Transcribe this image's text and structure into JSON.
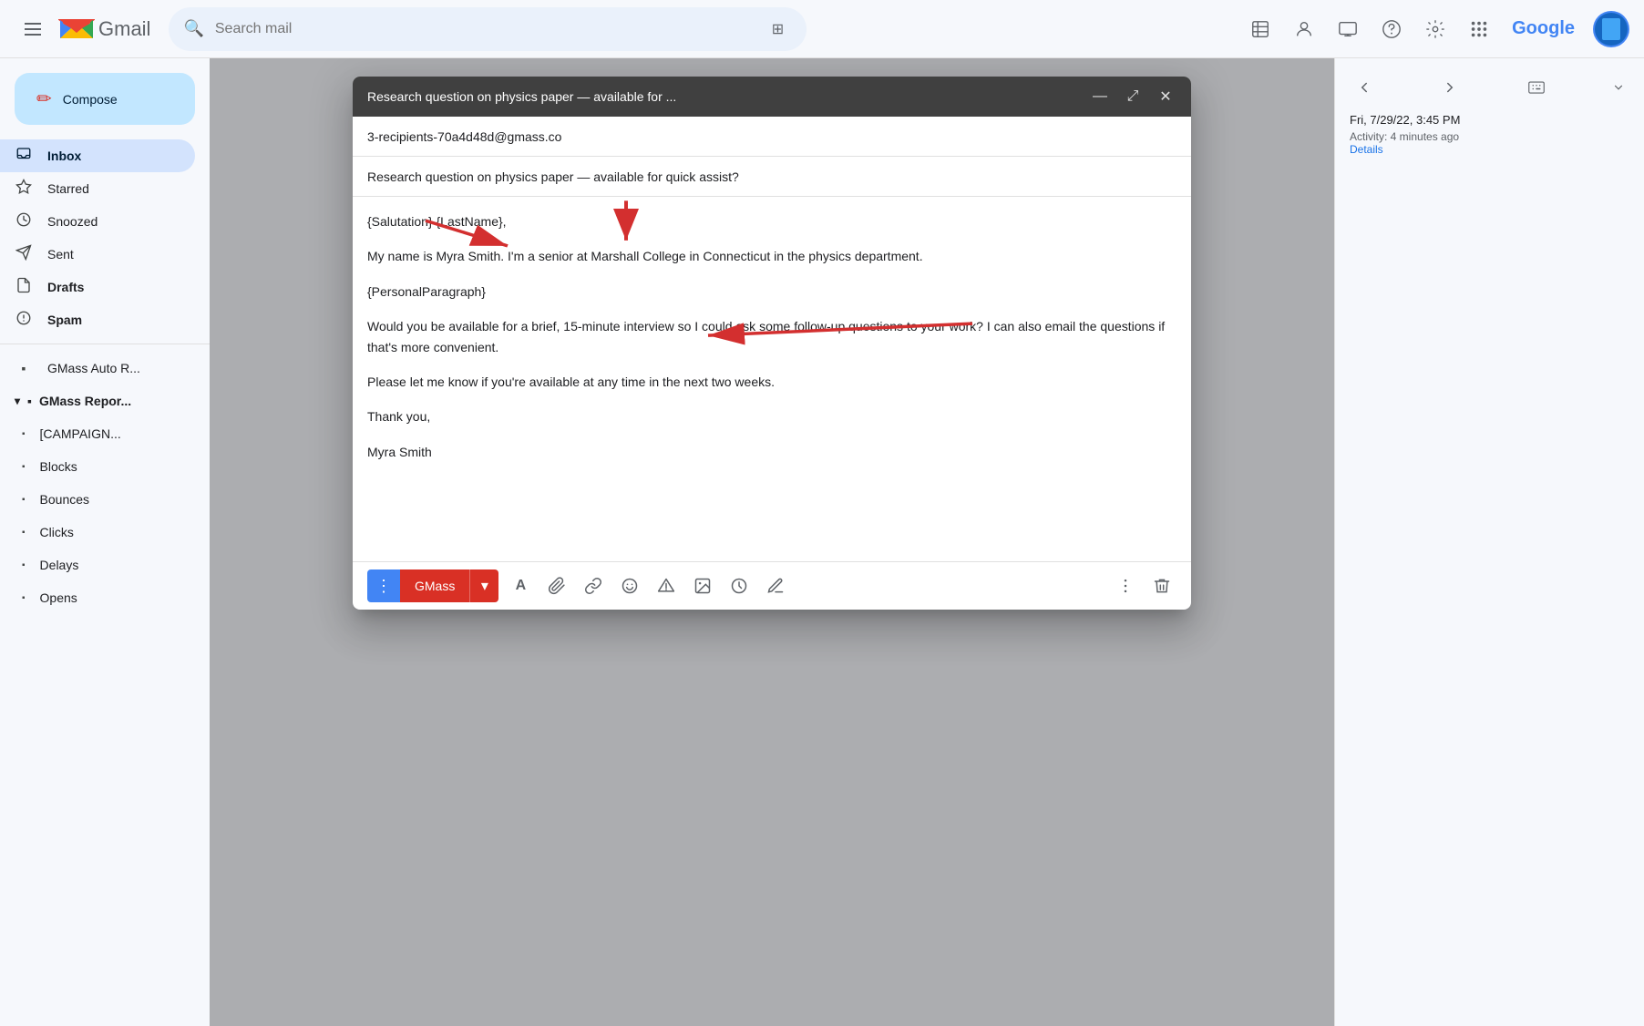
{
  "topbar": {
    "menu_label": "☰",
    "gmail_m": "M",
    "gmail_text": "Gmail",
    "search_placeholder": "Search mail",
    "icons": [
      "⊞",
      "⊟",
      "👤",
      "?",
      "⚙",
      "⋮⋮⋮"
    ],
    "google_text": "Google"
  },
  "sidebar": {
    "compose_label": "Compose",
    "items": [
      {
        "id": "inbox",
        "label": "Inbox",
        "icon": "☐",
        "active": true
      },
      {
        "id": "starred",
        "label": "Starred",
        "icon": "☆"
      },
      {
        "id": "snoozed",
        "label": "Snoozed",
        "icon": "◷"
      },
      {
        "id": "sent",
        "label": "Sent",
        "icon": "▷"
      },
      {
        "id": "drafts",
        "label": "Drafts",
        "icon": "□",
        "bold": true
      },
      {
        "id": "spam",
        "label": "Spam",
        "icon": "⊗",
        "bold": true
      }
    ],
    "gmass_auto": {
      "label": "GMass Auto R...",
      "icon": "▪"
    },
    "gmass_reports": {
      "label": "GMass Repor...",
      "icon": "▾▪"
    },
    "campaign": {
      "label": "[CAMPAIGN...",
      "icon": "▪"
    },
    "blocks": {
      "label": "Blocks",
      "icon": "▪"
    },
    "bounces": {
      "label": "Bounces",
      "icon": "▪"
    },
    "clicks": {
      "label": "Clicks",
      "icon": "▪"
    },
    "delays": {
      "label": "Delays",
      "icon": "▪"
    },
    "opens": {
      "label": "Opens",
      "icon": "▪"
    }
  },
  "compose_modal": {
    "title": "Research question on physics paper — available for ...",
    "header_buttons": {
      "minimize": "—",
      "maximize": "⤢",
      "close": "✕"
    },
    "to_field": "3-recipients-70a4d48d@gmass.co",
    "subject_field": "Research question on physics paper — available for quick assist?",
    "body": {
      "salutation": "{Salutation} {LastName},",
      "line1": "My name is Myra Smith. I'm a senior at Marshall College in Connecticut in the physics department.",
      "personal": "{PersonalParagraph}",
      "line2": "Would you be available for a brief, 15-minute interview so I could ask some follow-up questions to your work? I can also email the questions if that's more convenient.",
      "line3": "Please let me know if you're available at any time in the next two weeks.",
      "closing": "Thank you,",
      "signature": "Myra Smith"
    },
    "toolbar": {
      "dots_btn": "⋮",
      "gmass_label": "GMass",
      "gmass_arrow": "▾",
      "format_btn": "A",
      "attach_btn": "📎",
      "link_btn": "🔗",
      "emoji_btn": "☺",
      "drive_btn": "△",
      "image_btn": "🖼",
      "schedule_btn": "🕐",
      "pen_btn": "✏",
      "more_btn": "⋮",
      "delete_btn": "🗑"
    }
  },
  "right_panel": {
    "date": "Fri, 7/29/22, 3:45 PM",
    "activity": "Activity: 4 minutes ago",
    "details": "Details"
  },
  "annotations": {
    "arrow1_label": "arrow pointing to salutation",
    "arrow2_label": "arrow pointing to lastname",
    "arrow3_label": "arrow pointing to personal paragraph"
  }
}
